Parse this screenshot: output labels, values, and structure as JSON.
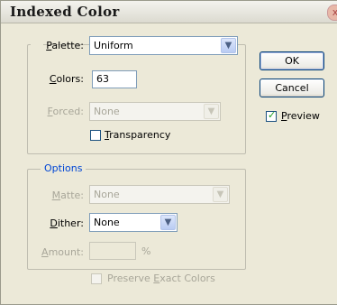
{
  "window": {
    "title": "Indexed Color",
    "close_glyph": "x"
  },
  "palette": {
    "label_pre": "",
    "label_key": "P",
    "label_post": "alette:",
    "value": "Uniform"
  },
  "colors": {
    "label_pre": "",
    "label_key": "C",
    "label_post": "olors:",
    "value": "63"
  },
  "forced": {
    "label_pre": "",
    "label_key": "F",
    "label_post": "orced:",
    "value": "None"
  },
  "transparency": {
    "label_pre": "",
    "label_key": "T",
    "label_post": "ransparency",
    "checked": false
  },
  "options": {
    "legend": "Options",
    "matte": {
      "label_pre": "",
      "label_key": "M",
      "label_post": "atte:",
      "value": "None"
    },
    "dither": {
      "label_pre": "",
      "label_key": "D",
      "label_post": "ither:",
      "value": "None"
    },
    "amount": {
      "label_pre": "",
      "label_key": "A",
      "label_post": "mount:",
      "value": "",
      "unit": "%"
    },
    "preserve": {
      "label_pre": "Preserve ",
      "label_key": "E",
      "label_post": "xact Colors",
      "checked": false
    }
  },
  "buttons": {
    "ok": "OK",
    "cancel": "Cancel"
  },
  "preview": {
    "label_pre": "",
    "label_key": "P",
    "label_post": "review",
    "checked": true
  },
  "colors_theme": {
    "dialog_bg": "#ece9d8",
    "legend_blue": "#0046d5",
    "disabled_text": "#a8a699",
    "field_border": "#7f9db9"
  }
}
